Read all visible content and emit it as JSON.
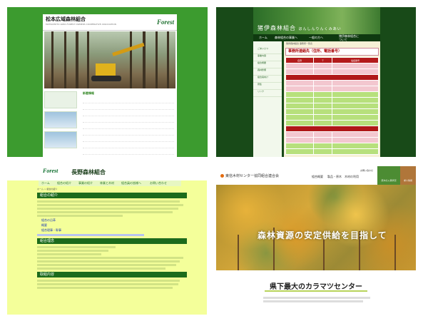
{
  "panel1": {
    "title": "松本広域森林組合",
    "subtitle": "MATSUMOTO AREA FOREST OWNERS COOPERATIVE ASSOCIATION",
    "logo": "Forest",
    "news_title": "新着情報"
  },
  "panel2": {
    "title": "猪伊森林組合",
    "title_suffix": "ほんしんりんくみあい",
    "nav": [
      "ホーム",
      "森林組合の事業へ",
      "一般の方へ",
      "猪伊森林組合に",
      "ついて"
    ],
    "sidebar": [
      "ごあいさつ",
      "事業内容",
      "組合概要",
      "森林整備",
      "組合員向け",
      "募集",
      "リンク"
    ],
    "breadcrumb": "猪伊森林組合 事務所一覧表",
    "content_title": "事務所連絡先（住所、電話番号）",
    "table_headers": [
      "名称",
      "〒",
      "電話番号"
    ]
  },
  "panel3": {
    "logo": "Forest",
    "title": "長野森林組合",
    "nav": [
      "ホーム",
      "組合の紹介",
      "事業の紹介",
      "林業と木材",
      "組合員の皆様へ",
      "お問い合わせ"
    ],
    "breadcrumb": "ホーム > 組合の紹介",
    "section1": "組合の紹介",
    "links": [
      "組合の沿革",
      "概要",
      "組合理事・幹事"
    ],
    "section2": "組合理念",
    "section3": "取組内容"
  },
  "panel4": {
    "logo": "東信木材センター協同組合連合会",
    "nav": [
      "組合概要",
      "製品・原木",
      "木材の利用",
      "お問い合わせ"
    ],
    "btn1": "原木の入荷状況",
    "btn2": "求人情報",
    "hero_text": "森林資源の安定供給を目指して",
    "heading": "県下最大のカラマツセンター"
  }
}
